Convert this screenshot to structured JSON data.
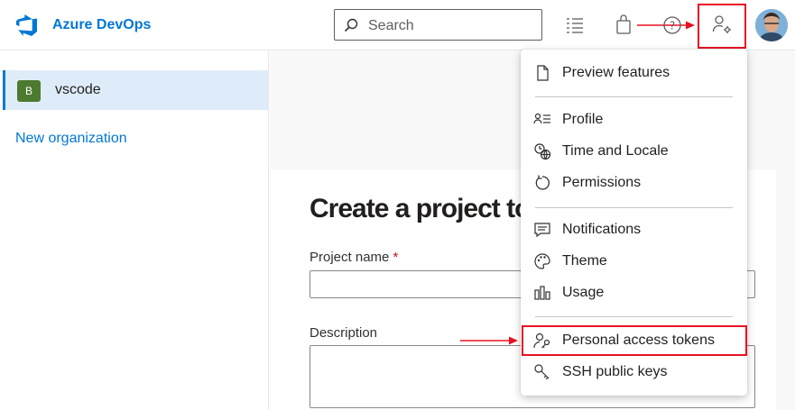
{
  "header": {
    "brand": "Azure DevOps",
    "search_placeholder": "Search",
    "icons": [
      "azure-devops-logo",
      "search-icon",
      "task-list-icon",
      "shopping-bag-icon",
      "help-icon",
      "user-settings-icon",
      "avatar"
    ]
  },
  "sidebar": {
    "organizations": [
      {
        "badge": "B",
        "name": "vscode",
        "selected": true
      }
    ],
    "new_org_label": "New organization"
  },
  "main": {
    "heading": "Create a project to get started",
    "project_name_label": "Project name",
    "required_marker": "*",
    "description_label": "Description"
  },
  "user_menu": {
    "items": [
      {
        "icon": "document-icon",
        "label": "Preview features"
      },
      {
        "icon": "profile-icon",
        "label": "Profile"
      },
      {
        "icon": "globe-clock-icon",
        "label": "Time and Locale"
      },
      {
        "icon": "permissions-icon",
        "label": "Permissions"
      },
      {
        "icon": "notifications-icon",
        "label": "Notifications"
      },
      {
        "icon": "palette-icon",
        "label": "Theme"
      },
      {
        "icon": "usage-icon",
        "label": "Usage"
      },
      {
        "icon": "personal-token-icon",
        "label": "Personal access tokens",
        "highlighted": true
      },
      {
        "icon": "ssh-key-icon",
        "label": "SSH public keys"
      }
    ]
  },
  "colors": {
    "accent": "#0078d4",
    "annotation": "#e81123",
    "badge": "#4c7a2f",
    "selected_bg": "#deecf9"
  }
}
